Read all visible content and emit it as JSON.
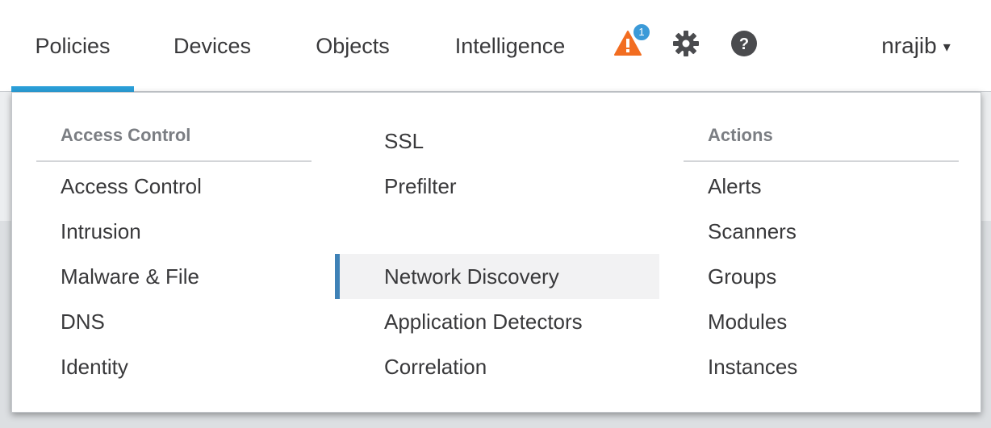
{
  "nav": {
    "tabs": [
      {
        "label": "Policies",
        "active": true
      },
      {
        "label": "Devices",
        "active": false
      },
      {
        "label": "Objects",
        "active": false
      },
      {
        "label": "Intelligence",
        "active": false
      }
    ],
    "alerts_count": "1",
    "icons": [
      "warning-icon",
      "gear-icon",
      "help-icon"
    ],
    "user": {
      "name": "nrajib",
      "caret": "▾"
    }
  },
  "menu": {
    "col1": {
      "heading": "Access Control",
      "items": [
        "Access Control",
        "Intrusion",
        "Malware & File",
        "DNS",
        "Identity"
      ]
    },
    "col2": {
      "top_items": [
        "SSL",
        "Prefilter"
      ],
      "items": [
        "Network Discovery",
        "Application Detectors",
        "Correlation"
      ],
      "highlighted": "Network Discovery"
    },
    "col3": {
      "heading": "Actions",
      "items": [
        "Alerts",
        "Scanners",
        "Groups",
        "Modules",
        "Instances"
      ]
    }
  },
  "colors": {
    "accent": "#2b9fd9",
    "warning": "#f26d21",
    "badge": "#3b9ad8",
    "highlight_bar": "#3f82b7"
  }
}
